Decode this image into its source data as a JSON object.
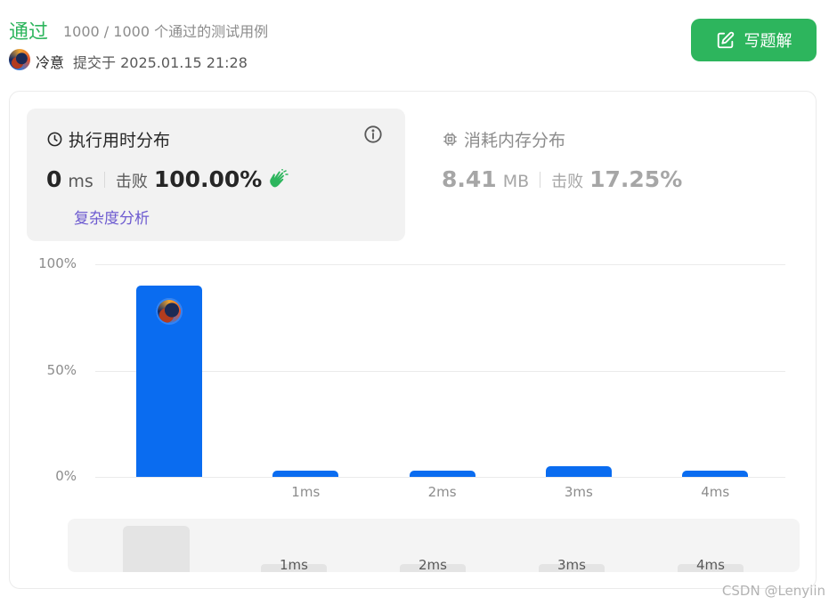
{
  "header": {
    "status": "通过",
    "cases_text": "1000 / 1000 个通过的测试用例",
    "username": "冷意",
    "submitted_text": "提交于 2025.01.15 21:28",
    "solution_button": "写题解"
  },
  "runtime": {
    "title": "执行用时分布",
    "value": "0",
    "unit": "ms",
    "beat_label": "击败",
    "beat_value": "100.00%",
    "complexity_link": "复杂度分析"
  },
  "memory": {
    "title": "消耗内存分布",
    "value": "8.41",
    "unit": "MB",
    "beat_label": "击败",
    "beat_value": "17.25%"
  },
  "chart_data": {
    "type": "bar",
    "categories": [
      "",
      "1ms",
      "2ms",
      "3ms",
      "4ms"
    ],
    "values": [
      90,
      3,
      3,
      5,
      3
    ],
    "ylim": [
      0,
      100
    ],
    "yticks": [
      "100%",
      "50%",
      "0%"
    ],
    "grid": true,
    "highlight_index": 0
  },
  "navigator": {
    "labels": [
      "1ms",
      "2ms",
      "3ms",
      "4ms"
    ]
  },
  "colors": {
    "accent_green": "#2db55d",
    "bar_blue": "#0a6cf0",
    "link_purple": "#6d5bd0"
  },
  "watermark": "CSDN @Lenyiin"
}
